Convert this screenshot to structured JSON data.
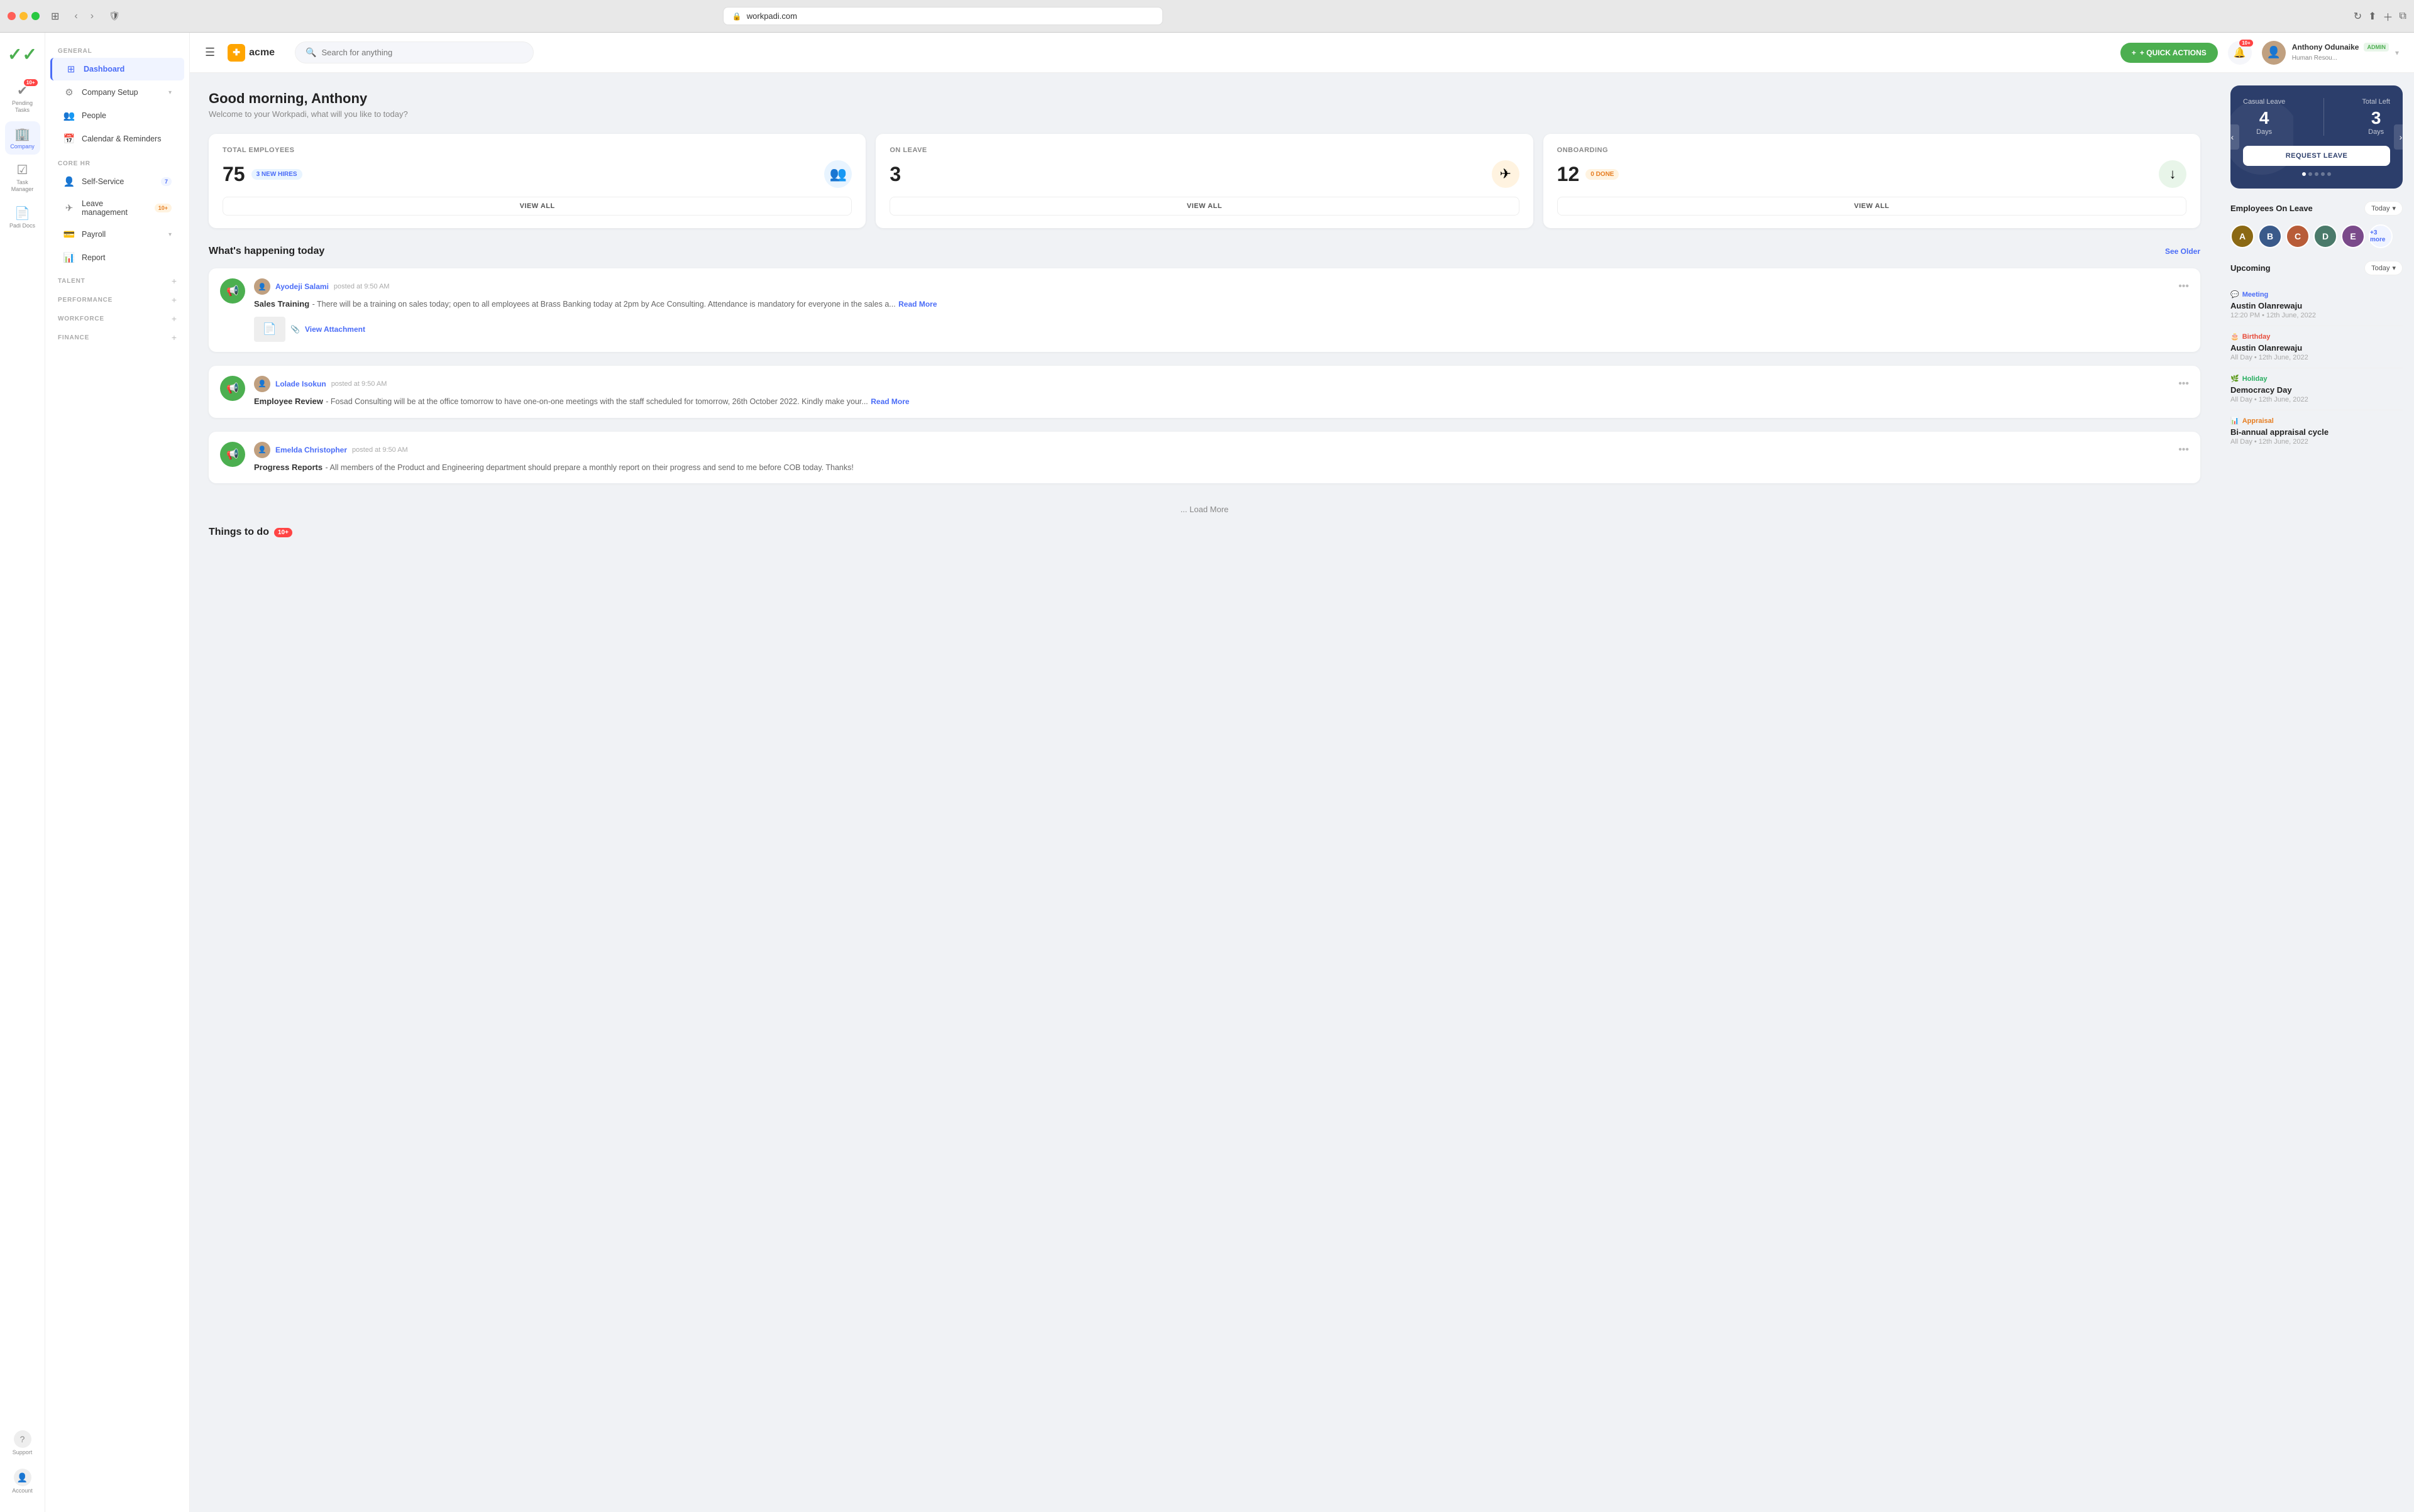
{
  "browser": {
    "url": "workpadi.com",
    "back": "‹",
    "forward": "›"
  },
  "topbar": {
    "logo_text": "acme",
    "search_placeholder": "Search for anything",
    "quick_actions_label": "+ QUICK ACTIONS",
    "notification_badge": "10+",
    "user_name": "Anthony Odunaike",
    "user_role": "Human Resou...",
    "admin_label": "ADMIN"
  },
  "rail": {
    "items": [
      {
        "id": "pending-tasks",
        "label": "Pending Tasks",
        "icon": "✓✓",
        "badge": "10+"
      },
      {
        "id": "company",
        "label": "Company",
        "icon": "🏢",
        "badge": null,
        "active": true
      },
      {
        "id": "task-manager",
        "label": "Task Manager",
        "icon": "✔",
        "badge": null
      },
      {
        "id": "padi-docs",
        "label": "Padi Docs",
        "icon": "📄",
        "badge": null
      }
    ],
    "bottom": [
      {
        "id": "support",
        "label": "Support",
        "icon": "?"
      },
      {
        "id": "account",
        "label": "Account",
        "icon": "👤"
      }
    ]
  },
  "sidebar": {
    "general_label": "GENERAL",
    "items": [
      {
        "id": "dashboard",
        "label": "Dashboard",
        "icon": "⊞",
        "active": true,
        "badge": null
      },
      {
        "id": "company-setup",
        "label": "Company Setup",
        "icon": "⚙",
        "active": false,
        "chevron": true
      },
      {
        "id": "people",
        "label": "People",
        "icon": "👥",
        "active": false
      },
      {
        "id": "calendar",
        "label": "Calendar & Reminders",
        "icon": "📅",
        "active": false
      }
    ],
    "core_hr_label": "CORE HR",
    "core_items": [
      {
        "id": "self-service",
        "label": "Self-Service",
        "icon": "👤",
        "badge": "7"
      },
      {
        "id": "leave-management",
        "label": "Leave management",
        "icon": "✈",
        "badge": "10+"
      },
      {
        "id": "payroll",
        "label": "Payroll",
        "icon": "💳",
        "chevron": true
      },
      {
        "id": "report",
        "label": "Report",
        "icon": "📊"
      }
    ],
    "expandable": [
      {
        "id": "talent",
        "label": "TALENT"
      },
      {
        "id": "performance",
        "label": "PERFORMANCE"
      },
      {
        "id": "workforce",
        "label": "WORKFORCE"
      },
      {
        "id": "finance",
        "label": "FINANCE"
      }
    ]
  },
  "main": {
    "greeting": "Good morning, Anthony",
    "greeting_sub": "Welcome to your Workpadi, what will you like to today?",
    "stats": [
      {
        "label": "Total Employees",
        "value": "75",
        "badge": "3 NEW HIRES",
        "badge_type": "blue",
        "icon": "👥",
        "icon_type": "blue",
        "view_all": "VIEW ALL"
      },
      {
        "label": "On leave",
        "value": "3",
        "badge": null,
        "icon": "✈",
        "icon_type": "orange",
        "view_all": "VIEW ALL"
      },
      {
        "label": "Onboarding",
        "value": "12",
        "badge": "0 DONE",
        "badge_type": "orange",
        "icon": "↓",
        "icon_type": "green",
        "view_all": "VIEW ALL"
      }
    ],
    "feed_title": "What's happening today",
    "see_older": "See Older",
    "feed_items": [
      {
        "poster": "Ayodeji Salami",
        "time": "posted at 9:50 AM",
        "title": "Sales Training",
        "text": " - There will be a training on sales today; open to all employees at Brass Banking today at 2pm by Ace Consulting. Attendance is mandatory for everyone in the sales a...",
        "read_more": "Read More",
        "has_attachment": true,
        "attachment_label": "View Attachment"
      },
      {
        "poster": "Lolade Isokun",
        "time": "posted at 9:50 AM",
        "title": "Employee Review",
        "text": " - Fosad Consulting will be at the office tomorrow to have one-on-one meetings with the staff scheduled for tomorrow, 26th October 2022. Kindly make your...",
        "read_more": "Read More",
        "has_attachment": false
      },
      {
        "poster": "Emelda Christopher",
        "time": "posted at 9:50 AM",
        "title": "Progress Reports",
        "text": " - All members of the Product and Engineering department should prepare a monthly report on their progress and send to me before COB today. Thanks!",
        "read_more": null,
        "has_attachment": false
      }
    ],
    "load_more": "... Load More",
    "things_title": "Things to do",
    "things_badge": "10+"
  },
  "right_panel": {
    "leave_card": {
      "leave_type": "Casual Leave",
      "total_left": "Total Left",
      "days_value": "4",
      "days_label": "Days",
      "total_left_value": "3",
      "total_left_label": "Days",
      "request_btn": "REQUEST LEAVE"
    },
    "employees_on_leave_title": "Employees On Leave",
    "employees_filter": "Today",
    "employees": [
      {
        "color": "#8B6914",
        "initials": "A"
      },
      {
        "color": "#3a5a8a",
        "initials": "B"
      },
      {
        "color": "#b85c38",
        "initials": "C"
      },
      {
        "color": "#4a7a6a",
        "initials": "D"
      },
      {
        "color": "#7a4a8a",
        "initials": "E"
      }
    ],
    "more_employees": "+3 more",
    "upcoming_title": "Upcoming",
    "upcoming_filter": "Today",
    "upcoming_items": [
      {
        "type": "Meeting",
        "type_class": "meeting",
        "type_icon": "💬",
        "name": "Austin Olanrewaju",
        "time": "12:20 PM • 12th June, 2022"
      },
      {
        "type": "Birthday",
        "type_class": "birthday",
        "type_icon": "🎂",
        "name": "Austin Olanrewaju",
        "time": "All Day • 12th June, 2022"
      },
      {
        "type": "Holiday",
        "type_class": "holiday",
        "type_icon": "🌿",
        "name": "Democracy Day",
        "time": "All Day • 12th June, 2022"
      },
      {
        "type": "Appraisal",
        "type_class": "appraisal",
        "type_icon": "📊",
        "name": "Bi-annual appraisal cycle",
        "time": "All Day • 12th June, 2022"
      }
    ]
  }
}
